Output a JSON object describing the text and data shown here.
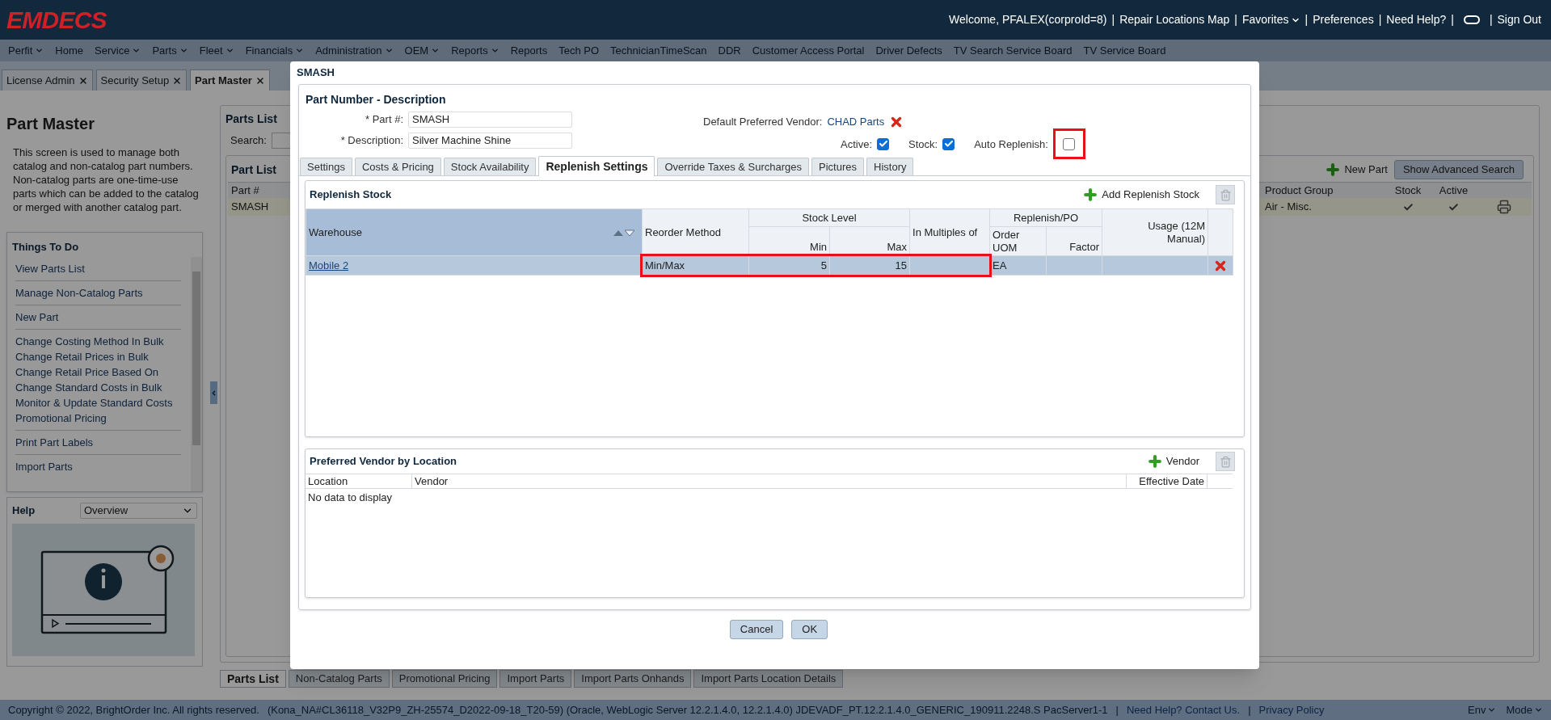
{
  "header": {
    "logo": "EMDECS",
    "items": [
      {
        "kind": "text",
        "label": "Welcome, PFALEX(corproId=8)"
      },
      {
        "kind": "separator",
        "label": "|"
      },
      {
        "kind": "link",
        "label": "Repair Locations Map"
      },
      {
        "kind": "separator",
        "label": "|"
      },
      {
        "kind": "menu",
        "label": "Favorites"
      },
      {
        "kind": "separator",
        "label": "|"
      },
      {
        "kind": "link",
        "label": "Preferences"
      },
      {
        "kind": "separator",
        "label": "|"
      },
      {
        "kind": "link",
        "label": "Need Help?"
      },
      {
        "kind": "separator",
        "label": "|"
      },
      {
        "kind": "toggle"
      },
      {
        "kind": "separator",
        "label": "|"
      },
      {
        "kind": "link",
        "label": "Sign Out"
      }
    ]
  },
  "nav": [
    {
      "label": "Perfit",
      "has_menu": true
    },
    {
      "label": "Home",
      "has_menu": false
    },
    {
      "label": "Service",
      "has_menu": true
    },
    {
      "label": "Parts",
      "has_menu": true
    },
    {
      "label": "Fleet",
      "has_menu": true
    },
    {
      "label": "Financials",
      "has_menu": true
    },
    {
      "label": "Administration",
      "has_menu": true
    },
    {
      "label": "OEM",
      "has_menu": true
    },
    {
      "label": "Reports",
      "has_menu": true
    },
    {
      "label": "Reports",
      "has_menu": false
    },
    {
      "label": "Tech PO",
      "has_menu": false
    },
    {
      "label": "TechnicianTimeScan",
      "has_menu": false
    },
    {
      "label": "DDR",
      "has_menu": false
    },
    {
      "label": "Customer Access Portal",
      "has_menu": false
    },
    {
      "label": "Driver Defects",
      "has_menu": false
    },
    {
      "label": "TV Search Service Board",
      "has_menu": false
    },
    {
      "label": "TV Service Board",
      "has_menu": false
    }
  ],
  "open_tabs": [
    {
      "label": "License Admin",
      "selected": false
    },
    {
      "label": "Security Setup",
      "selected": false
    },
    {
      "label": "Part Master",
      "selected": true
    }
  ],
  "left_panel": {
    "title": "Part Master",
    "description": "This screen is used to manage both catalog and non-catalog part numbers. Non-catalog parts are one-time-use parts which can be added to the catalog or merged with another catalog part.",
    "things_to_do": {
      "title": "Things To Do",
      "groups": [
        [
          "View Parts List"
        ],
        [
          "Manage Non-Catalog Parts"
        ],
        [
          "New Part"
        ],
        [
          "Change Costing Method In Bulk",
          "Change Retail Prices in Bulk",
          "Change Retail Price Based On",
          "Change Standard Costs in Bulk",
          "Monitor & Update Standard Costs",
          "Promotional Pricing"
        ],
        [
          "Print Part Labels"
        ],
        [
          "Import Parts"
        ]
      ]
    },
    "help": {
      "title": "Help",
      "select": "Overview"
    }
  },
  "parts_list": {
    "title": "Parts List",
    "search_label": "Search:",
    "part_list": {
      "title": "Part List",
      "new_part": "New Part",
      "advanced_search": "Show Advanced Search",
      "columns": [
        "Part #",
        "Product Group",
        "Stock",
        "Active"
      ],
      "rows": [
        {
          "part": "SMASH",
          "product_group": "Air - Misc.",
          "stock": true,
          "active": true
        }
      ]
    }
  },
  "bottom_tabs": [
    {
      "label": "Parts List",
      "selected": true
    },
    {
      "label": "Non-Catalog Parts",
      "selected": false
    },
    {
      "label": "Promotional Pricing",
      "selected": false
    },
    {
      "label": "Import Parts",
      "selected": false
    },
    {
      "label": "Import Parts Onhands",
      "selected": false
    },
    {
      "label": "Import Parts Location Details",
      "selected": false
    }
  ],
  "footer": {
    "copyright": "Copyright © 2022, BrightOrder Inc. All rights reserved.",
    "version": "(Kona_NA#CL36118_V32P9_ZH-25574_D2022-09-18_T20-59) (Oracle, WebLogic Server 12.2.1.4.0, 12.2.1.4.0) JDEVADF_PT.12.2.1.4.0_GENERIC_190911.2248.S PacServer1-1",
    "links": [
      {
        "kind": "separator",
        "label": "|"
      },
      {
        "kind": "link",
        "label": "Need Help? Contact Us."
      },
      {
        "kind": "separator",
        "label": "|"
      },
      {
        "kind": "link",
        "label": "Privacy Policy"
      }
    ],
    "menus": [
      "Env",
      "Mode"
    ]
  },
  "dialog": {
    "title": "SMASH",
    "section_title": "Part Number - Description",
    "part_label": "* Part #:",
    "part_value": "SMASH",
    "description_label": "* Description:",
    "description_value": "Silver Machine Shine",
    "vendor_label": "Default Preferred Vendor:",
    "vendor_value": "CHAD Parts",
    "flags": [
      {
        "label": "Active:",
        "checked": true,
        "highlighted": false
      },
      {
        "label": "Stock:",
        "checked": true,
        "highlighted": false
      },
      {
        "label": "Auto Replenish:",
        "checked": false,
        "highlighted": true
      }
    ],
    "tabs": [
      {
        "label": "Settings",
        "selected": false
      },
      {
        "label": "Costs & Pricing",
        "selected": false
      },
      {
        "label": "Stock Availability",
        "selected": false
      },
      {
        "label": "Replenish Settings",
        "selected": true
      },
      {
        "label": "Override Taxes & Surcharges",
        "selected": false
      },
      {
        "label": "Pictures",
        "selected": false
      },
      {
        "label": "History",
        "selected": false
      }
    ],
    "replenish_stock": {
      "title": "Replenish Stock",
      "add_label": "Add Replenish Stock",
      "column_groups": [
        {
          "label": "Stock Level"
        },
        {
          "label": "Replenish/PO"
        }
      ],
      "columns": [
        {
          "label": "Warehouse",
          "sorted": true
        },
        {
          "label": "Reorder Method",
          "sorted": false
        },
        {
          "label": "Min",
          "group_start": true
        },
        {
          "label": "Max",
          "in_group": true
        },
        {
          "label": "In Multiples of",
          "sorted": false
        },
        {
          "label": "Order UOM",
          "group_start": true
        },
        {
          "label": "Factor",
          "in_group": true
        },
        {
          "label": "Usage (12M Manual)",
          "sorted": false
        }
      ],
      "rows": [
        {
          "selected": true,
          "cells": [
            {
              "text": "Mobile 2",
              "kind": "link",
              "highlighted": false
            },
            {
              "text": "Min/Max",
              "highlighted": true
            },
            {
              "text": "5",
              "highlighted": true
            },
            {
              "text": "15",
              "highlighted": true
            },
            {
              "highlighted": true
            },
            {
              "text": "EA",
              "highlighted": false
            },
            {
              "highlighted": false
            },
            {
              "highlighted": false
            },
            {
              "kind": "delete",
              "highlighted": false
            }
          ]
        }
      ]
    },
    "vendors": {
      "title": "Preferred Vendor by Location",
      "add_label": "Vendor",
      "columns": [
        "Location",
        "Vendor",
        "Effective Date"
      ],
      "empty": "No data to display"
    },
    "buttons": [
      "Cancel",
      "OK"
    ]
  }
}
